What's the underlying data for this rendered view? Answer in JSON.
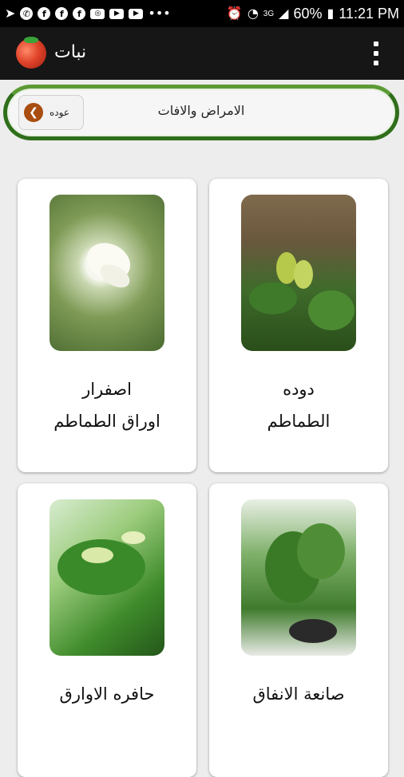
{
  "statusbar": {
    "battery": "60%",
    "time": "11:21 PM",
    "signal_label": "3G"
  },
  "appbar": {
    "title": "نبات"
  },
  "header": {
    "title": "الامراض والافات",
    "back_label": "عوده"
  },
  "cards": [
    {
      "line1": "دوده",
      "line2": "الطماطم"
    },
    {
      "line1": "اصفرار",
      "line2": "اوراق الطماطم"
    },
    {
      "line1": "صانعة الانفاق",
      "line2": ""
    },
    {
      "line1": "حافره الاوارق",
      "line2": ""
    }
  ],
  "colors": {
    "appbar": "#161616",
    "header_border": "#2f6e1b",
    "back_arrow": "#a94d10"
  }
}
